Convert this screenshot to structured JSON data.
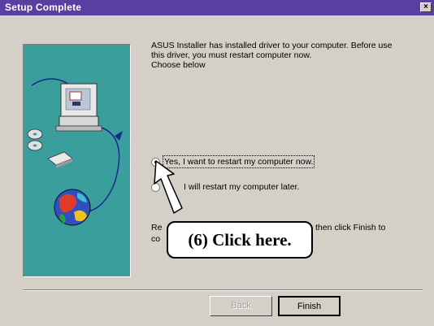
{
  "window": {
    "title": "Setup Complete",
    "close_glyph": "×"
  },
  "message": {
    "line1": "ASUS Installer has installed driver to your computer. Before use",
    "line2": "this driver, you must restart computer now.",
    "line3": "Choose below"
  },
  "options": [
    {
      "label": "Yes, I want to restart my computer now.",
      "selected": true
    },
    {
      "label": "I will restart my computer later.",
      "selected": false
    }
  ],
  "instruction": {
    "left_fragment": "Re",
    "right_fragment": "then click Finish to",
    "line2_fragment": "co"
  },
  "callout": {
    "text": "(6)  Click here."
  },
  "buttons": {
    "back_label": "Back",
    "finish_label": "Finish"
  },
  "colors": {
    "title_bar": "#5a3fa0",
    "panel": "#3a9e9c",
    "face": "#d4d0c8"
  }
}
